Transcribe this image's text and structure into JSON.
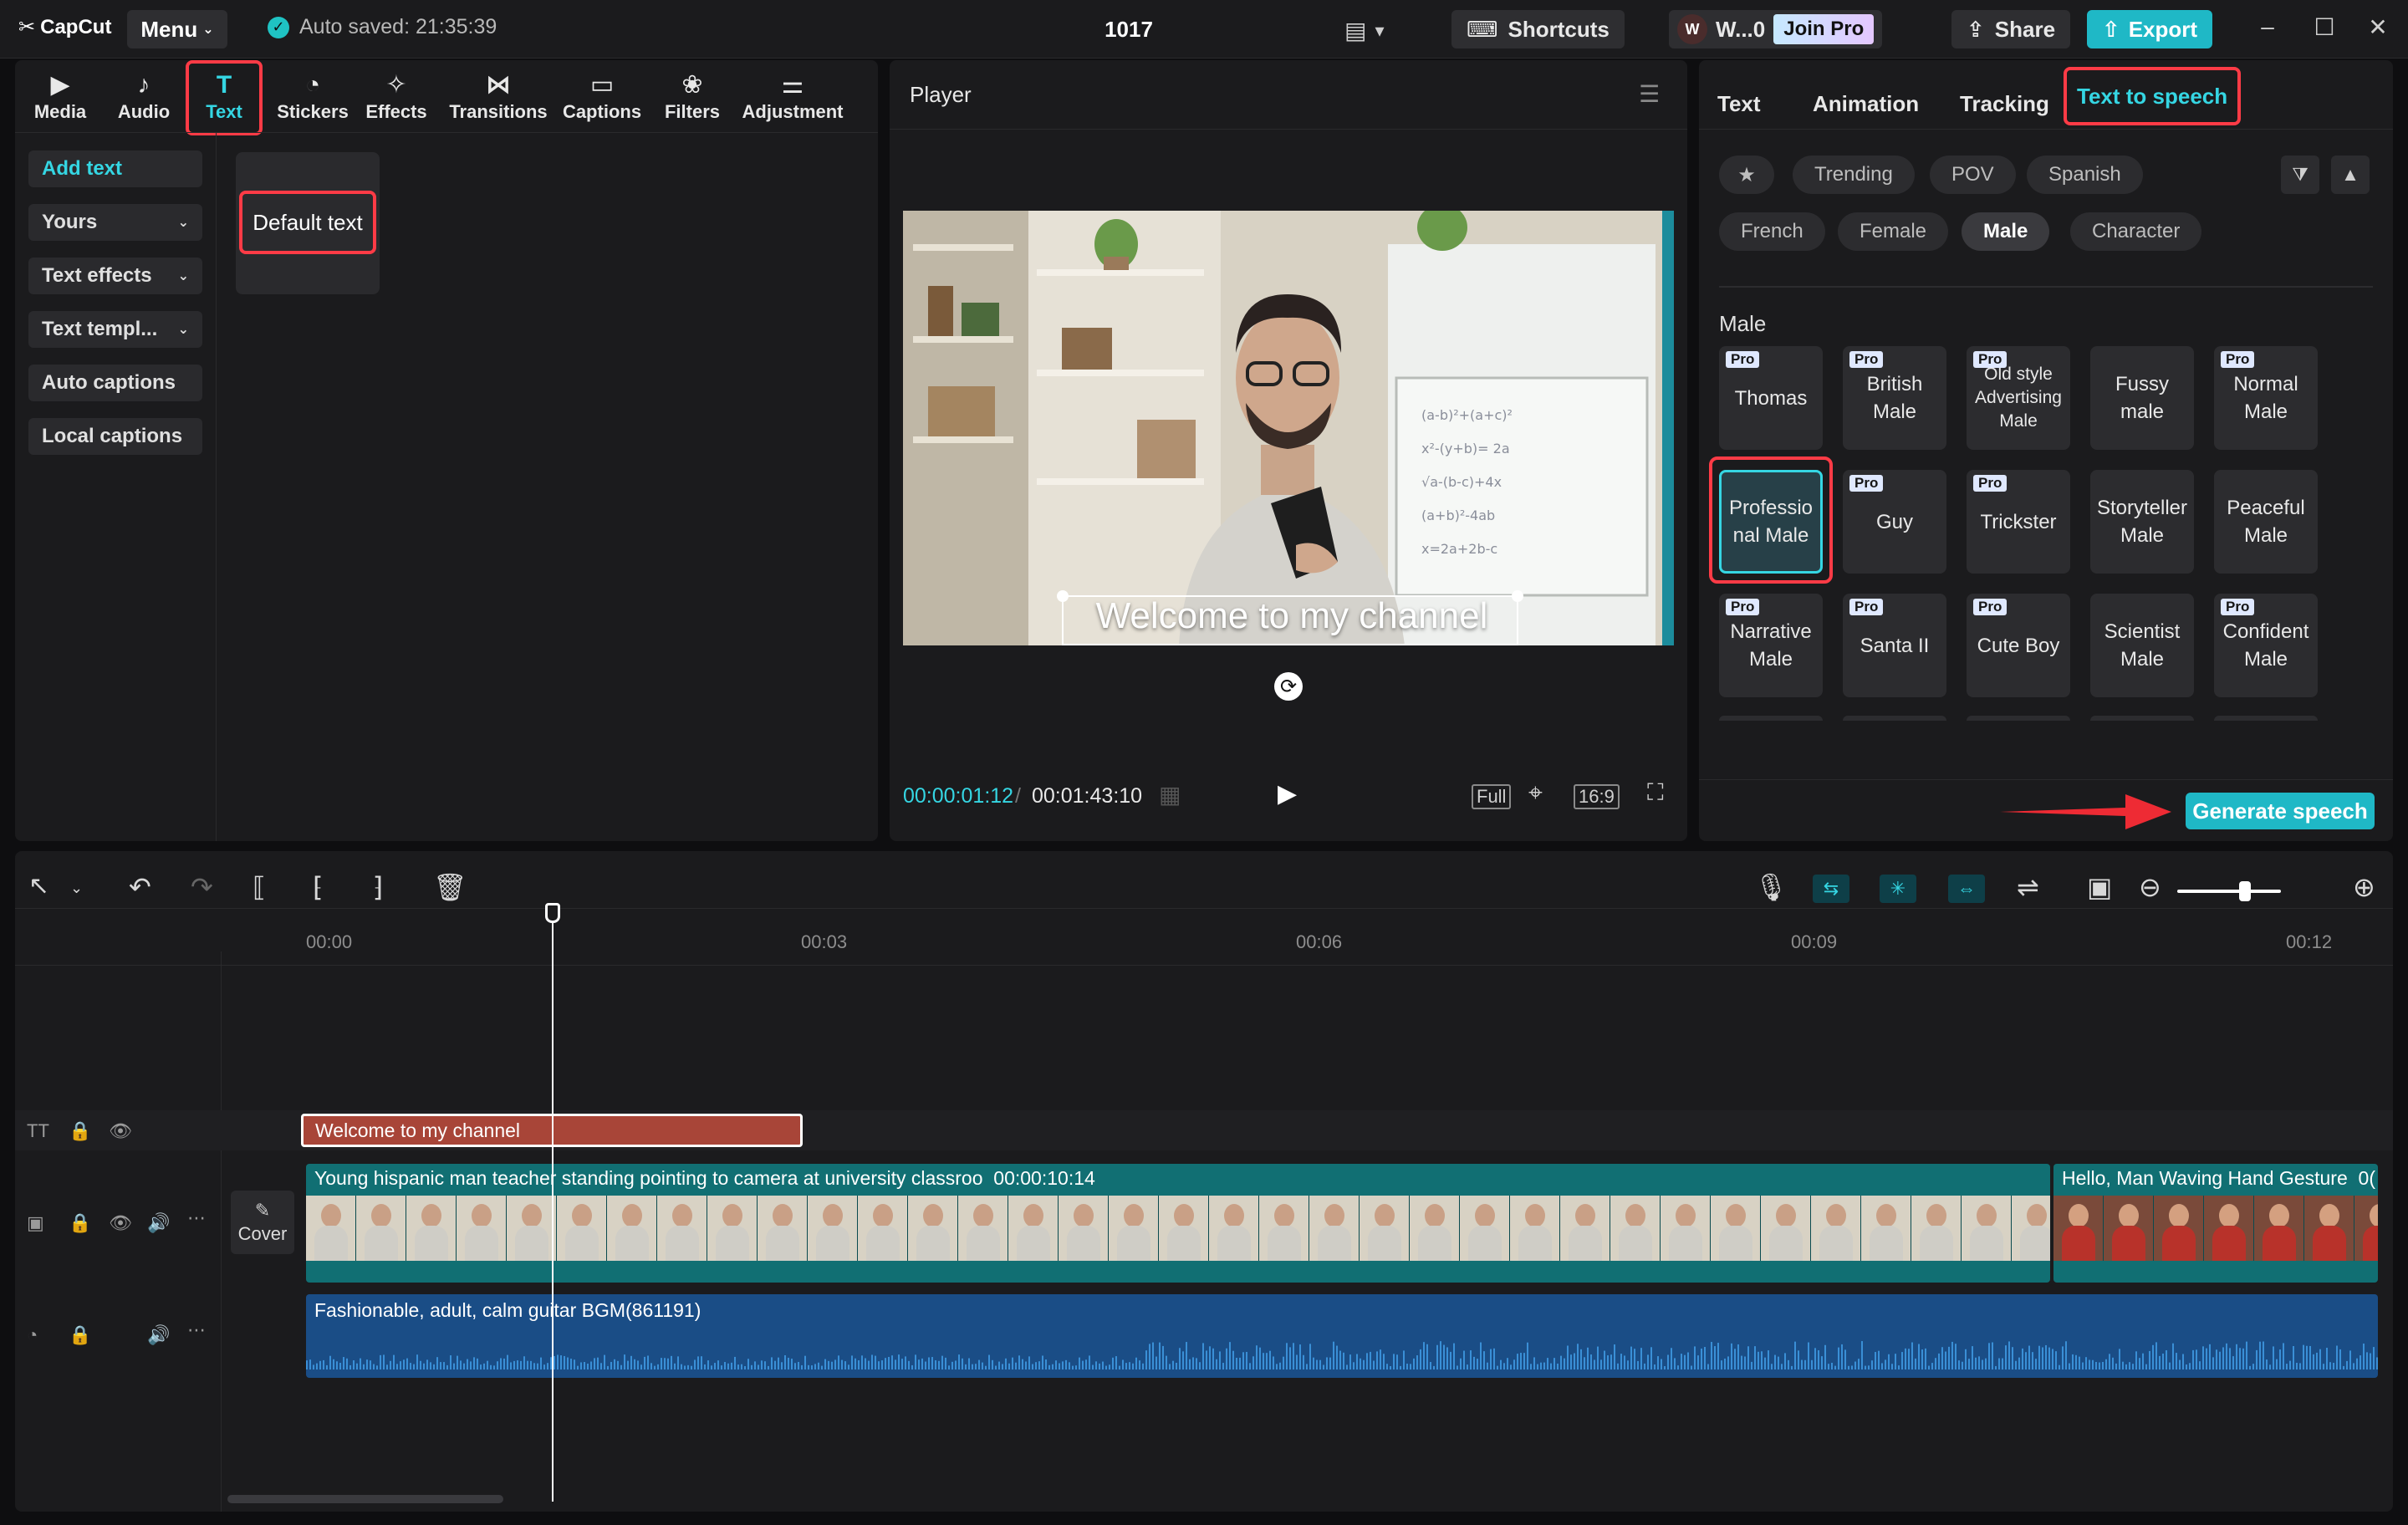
{
  "app": {
    "logo": "CapCut",
    "menu_label": "Menu",
    "autosave": "Auto saved: 21:35:39",
    "project_title": "1017",
    "shortcuts_label": "Shortcuts",
    "user_initial": "W",
    "user_name": "W...0",
    "join_pro": "Join Pro",
    "share_label": "Share",
    "export_label": "Export"
  },
  "tool_tabs": [
    {
      "label": "Media",
      "icon": "media-icon"
    },
    {
      "label": "Audio",
      "icon": "audio-icon"
    },
    {
      "label": "Text",
      "icon": "text-icon"
    },
    {
      "label": "Stickers",
      "icon": "stickers-icon"
    },
    {
      "label": "Effects",
      "icon": "effects-icon"
    },
    {
      "label": "Transitions",
      "icon": "transitions-icon"
    },
    {
      "label": "Captions",
      "icon": "captions-icon"
    },
    {
      "label": "Filters",
      "icon": "filters-icon"
    },
    {
      "label": "Adjustment",
      "icon": "adjustment-icon"
    }
  ],
  "active_tool_tab": "Text",
  "text_sidebar": [
    {
      "label": "Add text",
      "dropdown": false
    },
    {
      "label": "Yours",
      "dropdown": true
    },
    {
      "label": "Text effects",
      "dropdown": true
    },
    {
      "label": "Text templ...",
      "dropdown": true
    },
    {
      "label": "Auto captions",
      "dropdown": false
    },
    {
      "label": "Local captions",
      "dropdown": false
    }
  ],
  "default_text_card": "Default text",
  "player": {
    "title": "Player",
    "overlay_text": "Welcome to my channel",
    "current_time": "00:00:01:12",
    "total_time": "00:01:43:10",
    "full_label": "Full",
    "ratio_label": "16:9"
  },
  "right_panel": {
    "tabs": [
      "Text",
      "Animation",
      "Tracking",
      "Text to speech"
    ],
    "active_tab": "Text to speech",
    "filter_row1": [
      "Trending",
      "POV",
      "Spanish"
    ],
    "filter_row2": [
      "French",
      "Female",
      "Male",
      "Character"
    ],
    "active_filter": "Male",
    "section_title": "Male",
    "voices": [
      {
        "name": "Thomas",
        "pro": true
      },
      {
        "name": "British Male",
        "pro": true
      },
      {
        "name": "Old style Advertising Male",
        "pro": true
      },
      {
        "name": "Fussy male",
        "pro": false
      },
      {
        "name": "Normal Male",
        "pro": true
      },
      {
        "name": "Professional Male",
        "pro": false
      },
      {
        "name": "Guy",
        "pro": true
      },
      {
        "name": "Trickster",
        "pro": true
      },
      {
        "name": "Storyteller Male",
        "pro": false
      },
      {
        "name": "Peaceful Male",
        "pro": false
      },
      {
        "name": "Narrative Male",
        "pro": true
      },
      {
        "name": "Santa II",
        "pro": true
      },
      {
        "name": "Cute Boy",
        "pro": true
      },
      {
        "name": "Scientist Male",
        "pro": false
      },
      {
        "name": "Confident Male",
        "pro": true
      }
    ],
    "pro_badge": "Pro",
    "selected_voice": "Professional Male",
    "generate_label": "Generate speech"
  },
  "timeline": {
    "ticks": [
      "00:00",
      "00:03",
      "00:06",
      "00:09",
      "00:12"
    ],
    "text_clip": "Welcome to my channel",
    "video_clip_name": "Young hispanic man teacher standing pointing to camera at university classroo",
    "video_clip_duration": "00:00:10:14",
    "video_clip2_name": "Hello, Man Waving Hand Gesture",
    "video_clip2_tail": "0(",
    "audio_clip_name": "Fashionable, adult, calm guitar BGM(861191)",
    "cover_label": "Cover"
  },
  "colors": {
    "accent": "#35d6e3",
    "highlight": "#ff3b46",
    "export": "#1fb8c6",
    "video_track": "#116f73",
    "audio_track": "#1a4d86",
    "text_clip": "#a84538"
  }
}
